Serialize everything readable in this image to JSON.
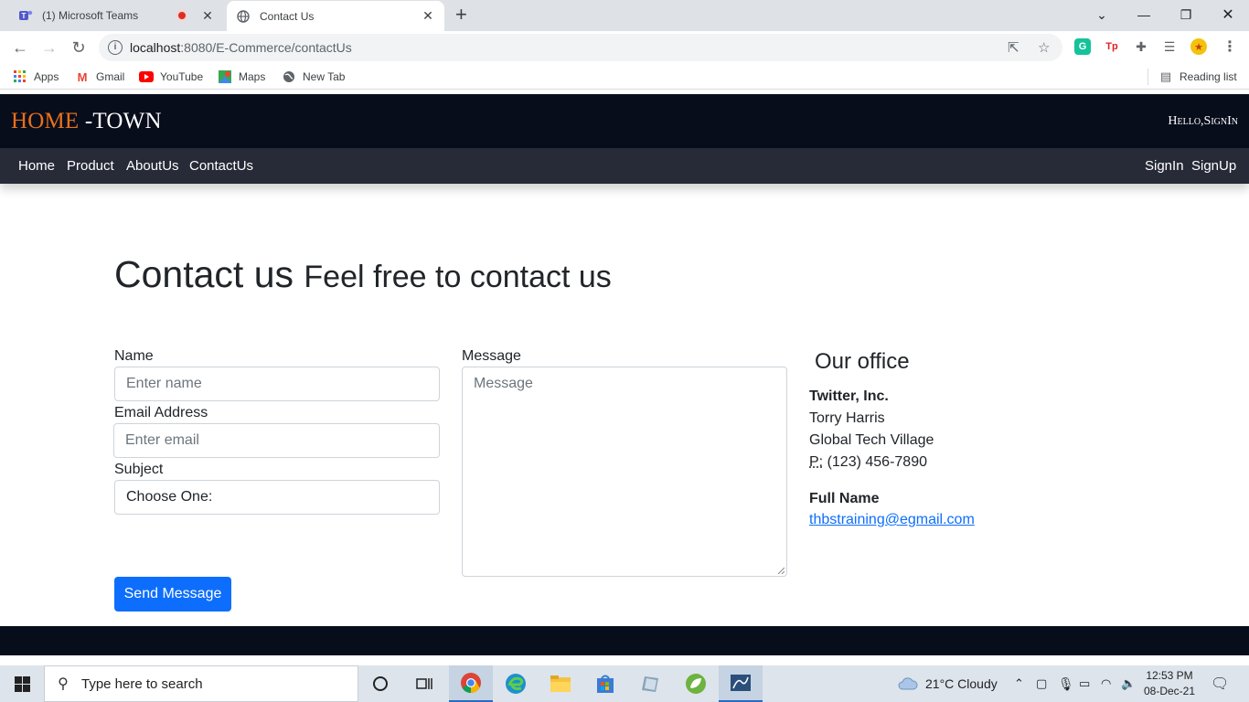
{
  "browser": {
    "tabs": [
      {
        "label": "(1) Microsoft Teams",
        "favicon": "teams-icon",
        "recording": true
      },
      {
        "label": "Contact Us",
        "favicon": "globe-icon",
        "active": true
      }
    ],
    "url_host": "localhost",
    "url_path": ":8080/E-Commerce/contactUs",
    "bookmarks": [
      {
        "label": "Apps",
        "icon": "apps-grid-icon"
      },
      {
        "label": "Gmail",
        "icon": "gmail-icon"
      },
      {
        "label": "YouTube",
        "icon": "youtube-icon"
      },
      {
        "label": "Maps",
        "icon": "maps-icon"
      },
      {
        "label": "New Tab",
        "icon": "globe-icon"
      }
    ],
    "reading_list": "Reading list",
    "extensions": [
      "grammarly-icon",
      "tp-icon",
      "puzzle-icon",
      "media-icon",
      "profile-icon"
    ]
  },
  "site": {
    "brand_home": "HOME",
    "brand_town": " -TOWN",
    "greeting": "Hello,SignIn",
    "nav": [
      "Home",
      "Product",
      "AboutUs",
      "ContactUs"
    ],
    "nav_right": [
      "SignIn",
      "SignUp"
    ]
  },
  "contact": {
    "heading": "Contact us",
    "subheading": "Feel free to contact us",
    "name_label": "Name",
    "name_placeholder": "Enter name",
    "email_label": "Email Address",
    "email_placeholder": "Enter email",
    "subject_label": "Subject",
    "subject_value": "Choose One:",
    "message_label": "Message",
    "message_placeholder": "Message",
    "send_label": "Send Message"
  },
  "office": {
    "title": "Our office",
    "company": "Twitter, Inc.",
    "line1": "Torry Harris",
    "line2": "Global Tech Village",
    "phone_abbr": "P:",
    "phone": " (123) 456-7890",
    "contact_name": "Full Name",
    "email": "thbstraining@egmail.com"
  },
  "taskbar": {
    "search_placeholder": "Type here to search",
    "weather": "21°C  Cloudy",
    "time": "12:53 PM",
    "date": "08-Dec-21"
  },
  "colors": {
    "topbar": "#080d1c",
    "navbar": "#272b38",
    "brand_accent": "#e8701a",
    "primary": "#0d6efd"
  }
}
